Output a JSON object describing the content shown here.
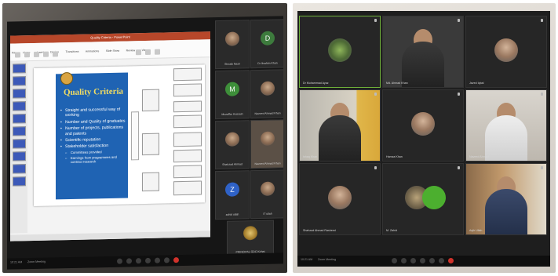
{
  "left": {
    "ppt": {
      "window_title": "Quality Criteria - PowerPoint",
      "tabs": [
        "File",
        "Home",
        "Insert",
        "Design",
        "Transitions",
        "Animations",
        "Slide Show",
        "Review",
        "View"
      ],
      "slide": {
        "title": "Quality Criteria",
        "bullets": [
          "Straight and successful way of working",
          "Number and Quality of graduates",
          "Number of projects, publications and patents",
          "Scientific reputation",
          "Stakeholder satisfaction"
        ],
        "sub_bullets": [
          "Committees provided",
          "Earnings from programmes and contract research"
        ]
      }
    },
    "tiles": [
      {
        "name": "Shoaib Nasir",
        "initial": "",
        "color": ""
      },
      {
        "name": "Dr Ibrahim Khan",
        "initial": "D",
        "color": "#3d7b3d"
      },
      {
        "name": "Muzaffar Hussain",
        "initial": "M",
        "color": "#3e8f3a"
      },
      {
        "name": "Naveed Ahmad Khan",
        "initial": "",
        "color": ""
      },
      {
        "name": "Shahzad Ahmad",
        "initial": "",
        "color": ""
      },
      {
        "name": "Naveed Ahmad Khan",
        "initial": "",
        "color": ""
      },
      {
        "name": "zahid ullah",
        "initial": "Z",
        "color": "#2f62c7"
      },
      {
        "name": "IT ullah",
        "initial": "",
        "color": ""
      },
      {
        "name": "PRINCIPAL GDC Kohat",
        "initial": "",
        "color": ""
      }
    ],
    "taskbar": {
      "clock": "10:21 AM",
      "meeting": "Zoom Meeting"
    }
  },
  "right": {
    "tiles": [
      {
        "name": "Dr Muhammad Ayaz",
        "kind": "avatar"
      },
      {
        "name": "Md. Ahmad Khan",
        "kind": "person"
      },
      {
        "name": "Javed Iqbal",
        "kind": "avatar"
      },
      {
        "name": "Ishaq Khan",
        "kind": "person"
      },
      {
        "name": "Hamza Khan",
        "kind": "avatar"
      },
      {
        "name": "Naveed Ahmad",
        "kind": "person"
      },
      {
        "name": "Shahzad Ahmad Rasheed",
        "kind": "avatar"
      },
      {
        "name": "M. Zahid",
        "kind": "avatar"
      },
      {
        "name": "Aqib Ullah",
        "kind": "person"
      }
    ],
    "taskbar": {
      "clock": "10:21 AM",
      "meeting": "Zoom Meeting"
    }
  }
}
